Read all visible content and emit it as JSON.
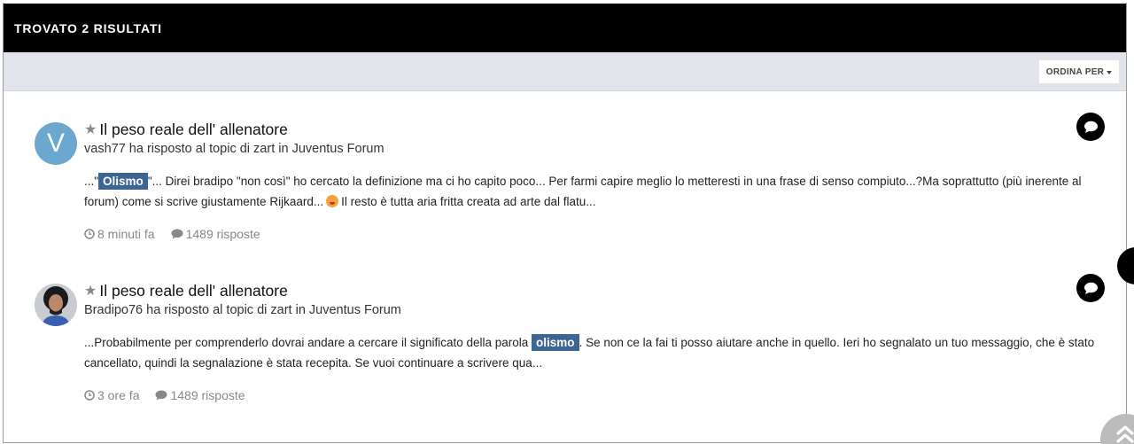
{
  "header": {
    "title": "TROVATO 2 RISULTATI"
  },
  "toolbar": {
    "sort_label": "ORDINA PER"
  },
  "results": [
    {
      "avatar_letter": "V",
      "title": "Il peso reale dell' allenatore",
      "author": "vash77",
      "action": "ha risposto al topic di",
      "topic_author": "zart",
      "in_label": "in",
      "forum": "Juventus Forum",
      "snippet_before": "...\"",
      "highlight": "Olismo",
      "snippet_after": "\"... Direi bradipo \"non così\" ho cercato la definizione ma ci ho capito poco... Per farmi capire meglio lo metteresti in una frase di senso compiuto...?Ma soprattutto (più inerente al forum) come si scrive giustamente Rijkaard...",
      "snippet_end": "Il resto è tutta aria fritta creata ad arte dal flatu...",
      "time": "8 minuti fa",
      "replies": "1489 risposte"
    },
    {
      "title": "Il peso reale dell' allenatore",
      "author": "Bradipo76",
      "action": "ha risposto al topic di",
      "topic_author": "zart",
      "in_label": "in",
      "forum": "Juventus Forum",
      "snippet_before": "...Probabilmente per comprenderlo dovrai andare a cercare il significato della parola",
      "highlight": "olismo",
      "snippet_after": ". Se non ce la fai ti posso aiutare anche in quello. Ieri ho segnalato un tuo messaggio, che è stato cancellato, quindi la segnalazione è stata recepita. Se vuoi continuare a scrivere qua...",
      "time": "3 ore fa",
      "replies": "1489 risposte"
    }
  ],
  "icons": {
    "star": "star-icon",
    "clock": "clock-icon",
    "comment": "comment-icon",
    "chevron": "double-chevron-up-icon"
  },
  "colors": {
    "header_bg": "#000000",
    "toolbar_bg": "#e1e5eb",
    "highlight_bg": "#3d6594",
    "avatar_bg": "#6ba7cf",
    "muted_text": "#888888"
  }
}
